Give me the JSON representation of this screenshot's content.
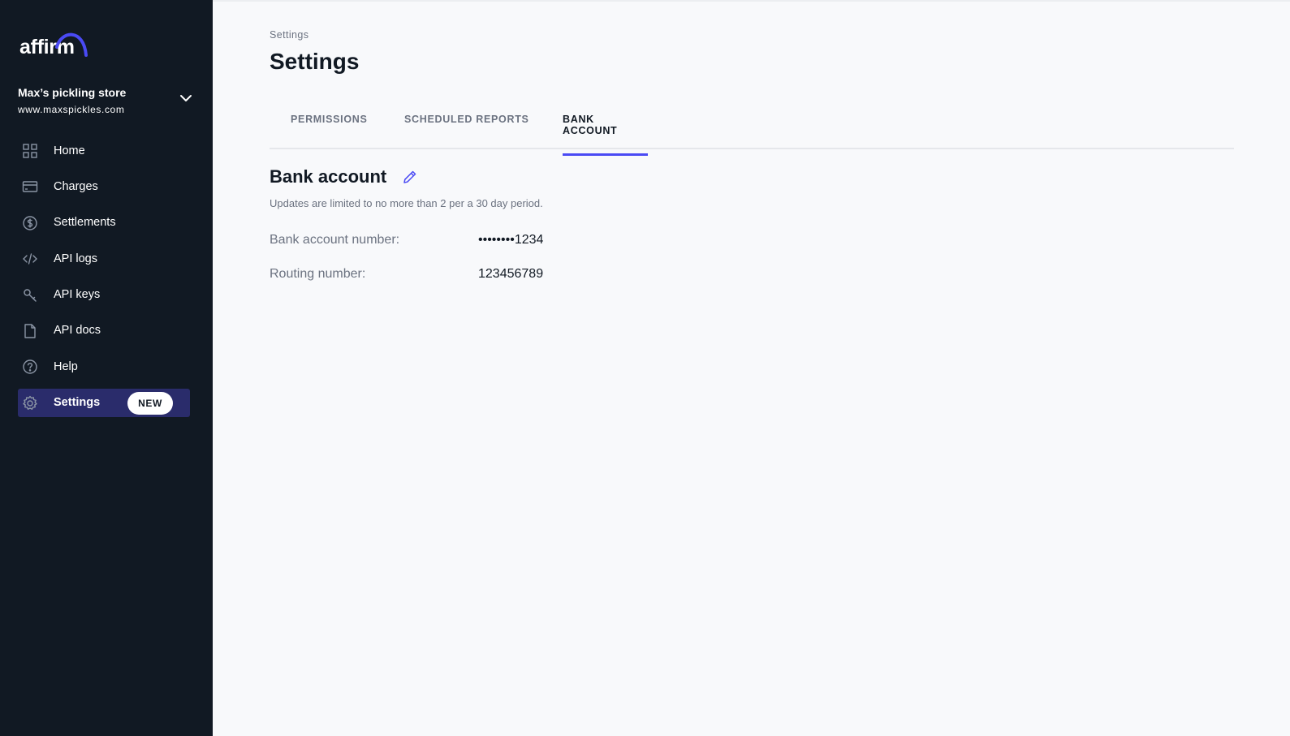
{
  "brand": {
    "name": "affirm",
    "accent": "#4a4af4"
  },
  "store": {
    "name": "Max’s pickling store",
    "url": "www.maxspickles.com"
  },
  "nav": {
    "items": [
      {
        "label": "Home",
        "icon": "grid-icon"
      },
      {
        "label": "Charges",
        "icon": "card-icon"
      },
      {
        "label": "Settlements",
        "icon": "dollar-circle-icon"
      },
      {
        "label": "API logs",
        "icon": "code-icon"
      },
      {
        "label": "API keys",
        "icon": "key-icon"
      },
      {
        "label": "API docs",
        "icon": "document-icon"
      },
      {
        "label": "Help",
        "icon": "help-circle-icon"
      },
      {
        "label": "Settings",
        "icon": "gear-icon",
        "active": true,
        "badge": "NEW"
      }
    ]
  },
  "page": {
    "breadcrumb": "Settings",
    "title": "Settings",
    "tabs": [
      {
        "label": "PERMISSIONS",
        "active": false
      },
      {
        "label": "SCHEDULED REPORTS",
        "active": false
      },
      {
        "label": "BANK ACCOUNT",
        "active": true
      }
    ]
  },
  "bank_account": {
    "heading": "Bank account",
    "note": "Updates are limited to no more than 2 per a 30 day period.",
    "fields": [
      {
        "label": "Bank account number:",
        "value": "••••••••1234"
      },
      {
        "label": "Routing number:",
        "value": "123456789"
      }
    ]
  }
}
